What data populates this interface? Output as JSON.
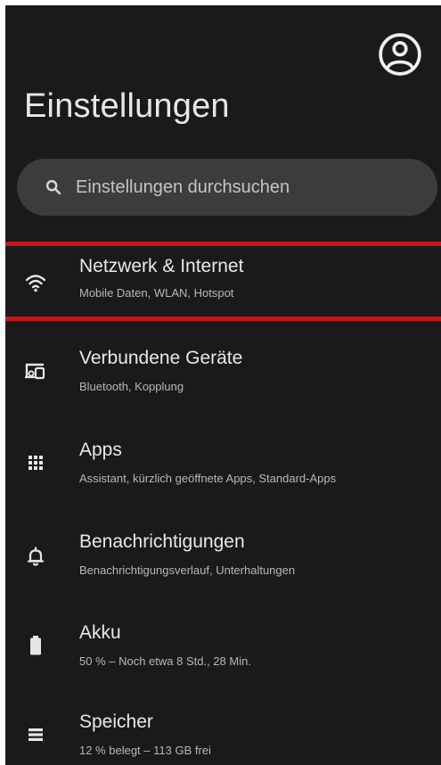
{
  "header": {
    "title": "Einstellungen",
    "avatar_icon": "account-circle-icon"
  },
  "search": {
    "placeholder": "Einstellungen durchsuchen",
    "icon": "search-icon"
  },
  "highlight_color": "#c8141c",
  "items": [
    {
      "icon": "wifi-icon",
      "title": "Netzwerk & Internet",
      "subtitle": "Mobile Daten, WLAN, Hotspot"
    },
    {
      "icon": "devices-icon",
      "title": "Verbundene Geräte",
      "subtitle": "Bluetooth, Kopplung"
    },
    {
      "icon": "apps-grid-icon",
      "title": "Apps",
      "subtitle": "Assistant, kürzlich geöffnete Apps, Standard-Apps"
    },
    {
      "icon": "bell-icon",
      "title": "Benachrichtigungen",
      "subtitle": "Benachrichtigungsverlauf, Unterhaltungen"
    },
    {
      "icon": "battery-icon",
      "title": "Akku",
      "subtitle": "50 % – Noch etwa 8 Std., 28 Min."
    },
    {
      "icon": "storage-icon",
      "title": "Speicher",
      "subtitle": "12 % belegt – 113 GB frei"
    }
  ]
}
